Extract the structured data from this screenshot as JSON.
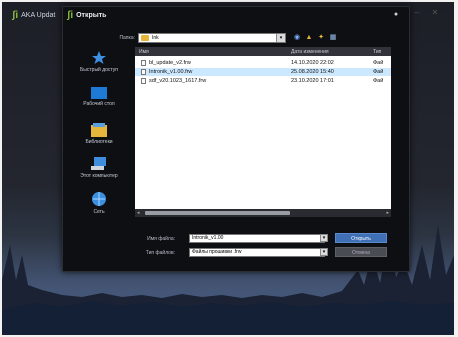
{
  "app": {
    "title": "AKA Updat",
    "logo_icon": "fi-logo-icon"
  },
  "dialog": {
    "title": "Открыть",
    "folder": {
      "label": "Папка:",
      "value": "Ink"
    },
    "places": [
      {
        "label": "Быстрый доступ",
        "icon": "star-icon"
      },
      {
        "label": "Рабочий стол",
        "icon": "desktop-icon"
      },
      {
        "label": "Библиотеки",
        "icon": "libraries-icon"
      },
      {
        "label": "Этот компьютер",
        "icon": "computer-icon"
      },
      {
        "label": "Сеть",
        "icon": "network-icon"
      }
    ],
    "columns": [
      "Имя",
      "Дата изменения",
      "Тип"
    ],
    "files": [
      {
        "name": "bl_update_v2.frw",
        "date": "14.10.2020 22:02",
        "type": "Фай",
        "selected": false
      },
      {
        "name": "Intronik_v1.00.frw",
        "date": "25.08.2020 15:40",
        "type": "Фай",
        "selected": true
      },
      {
        "name": "sdf_v20.1023_1617.frw",
        "date": "23.10.2020 17:01",
        "type": "Фай",
        "selected": false
      }
    ],
    "filename": {
      "label": "Имя файла:",
      "value": "Intronik_v1.00"
    },
    "filetype": {
      "label": "Тип файлов:",
      "value": "Файлы прошивки .frw"
    },
    "open_label": "Открыть",
    "cancel_label": "Отмена"
  }
}
